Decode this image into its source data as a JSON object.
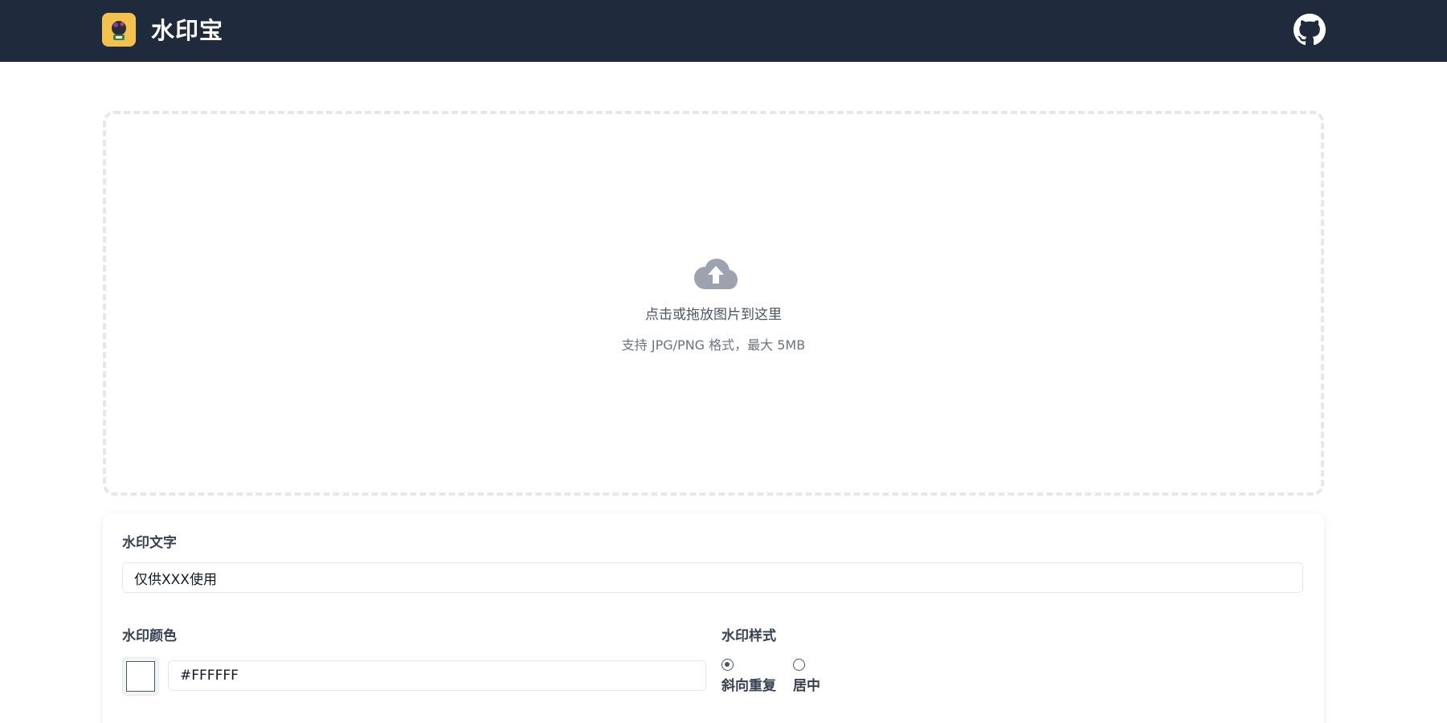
{
  "header": {
    "app_title": "水印宝",
    "logo_icon": "app-logo-icon",
    "github_icon": "github-icon",
    "background_color": "#1f2a3c"
  },
  "upload": {
    "icon": "cloud-upload-icon",
    "hint_main": "点击或拖放图片到这里",
    "hint_sub": "支持 JPG/PNG 格式，最大 5MB"
  },
  "settings": {
    "watermark_text_label": "水印文字",
    "watermark_text_value": "仅供XXX使用",
    "watermark_color_label": "水印颜色",
    "watermark_color_value": "#FFFFFF",
    "watermark_style_label": "水印样式",
    "style_options": [
      {
        "label": "斜向重复",
        "checked": true
      },
      {
        "label": "居中",
        "checked": false
      }
    ]
  }
}
